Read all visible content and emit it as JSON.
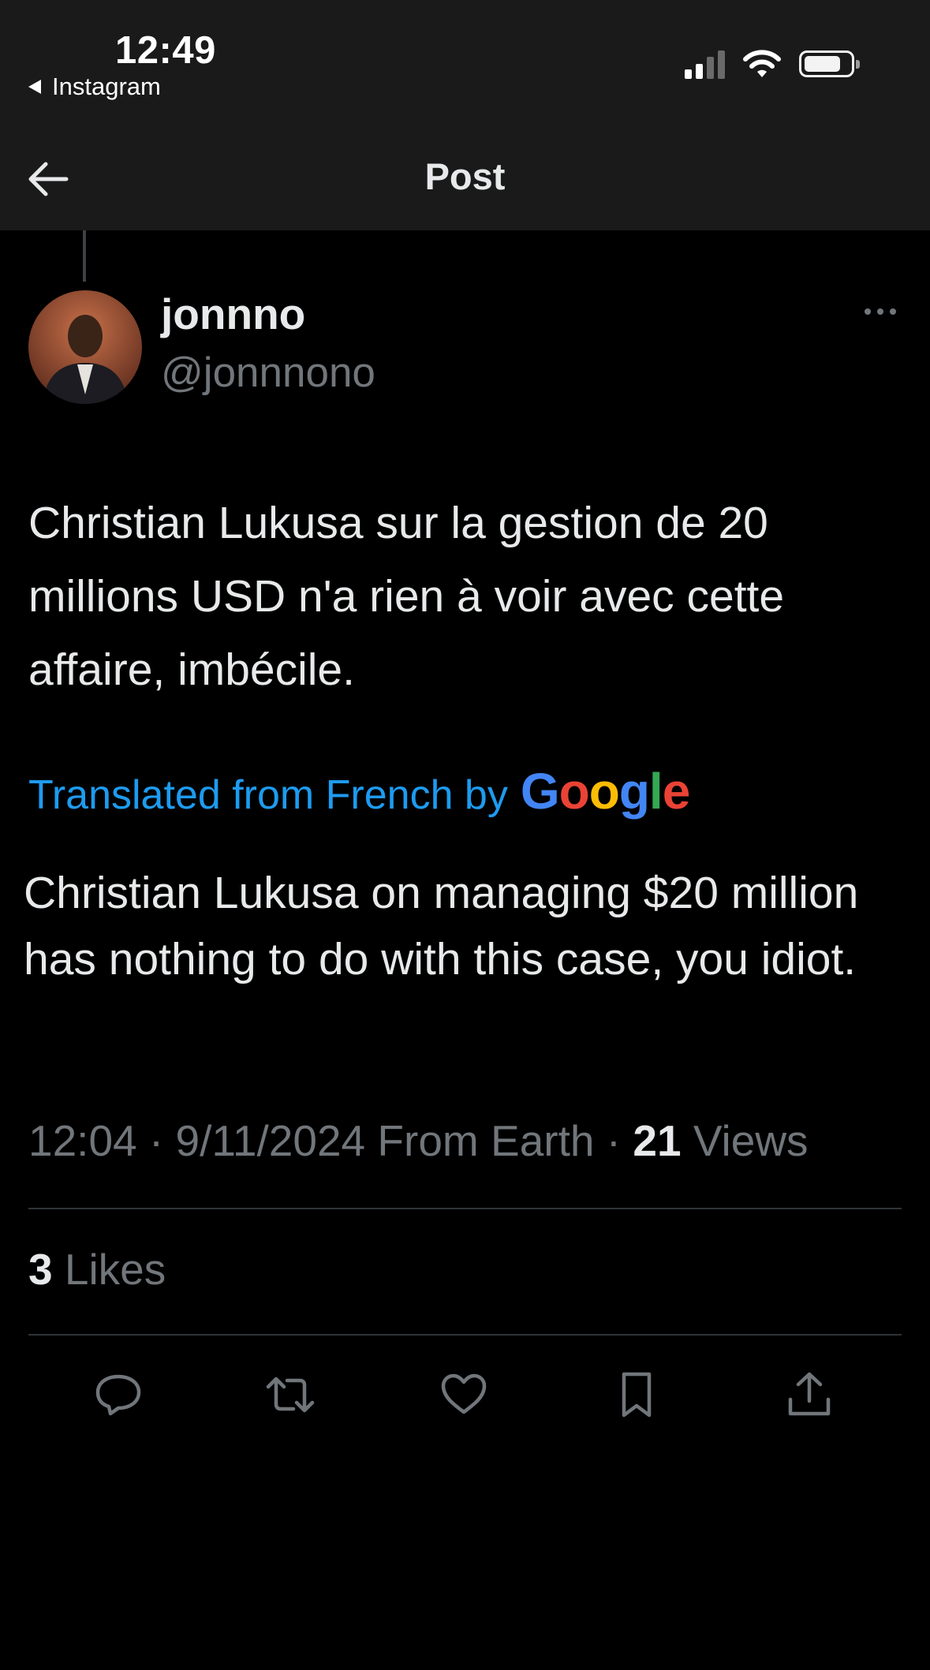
{
  "status_bar": {
    "time": "12:49",
    "back_app": "Instagram"
  },
  "header": {
    "title": "Post"
  },
  "author": {
    "name": "jonnno",
    "handle": "@jonnnono"
  },
  "post": {
    "text": "Christian Lukusa sur la gestion de 20 millions USD n'a rien à voir avec cette affaire, imbécile.",
    "translated_label": "Translated from French by",
    "translation_provider": "Google",
    "translation": "Christian Lukusa on managing $20 million has nothing to do with this case, you idiot."
  },
  "meta": {
    "time": "12:04",
    "date": "9/11/2024",
    "source": "From Earth",
    "views_count": "21",
    "views_label": "Views"
  },
  "stats": {
    "likes_count": "3",
    "likes_label": "Likes"
  },
  "actions": [
    {
      "name": "reply-icon"
    },
    {
      "name": "repost-icon"
    },
    {
      "name": "like-icon"
    },
    {
      "name": "bookmark-icon"
    },
    {
      "name": "share-icon"
    }
  ],
  "colors": {
    "background": "#000000",
    "text": "#e7e9ea",
    "secondary_text": "#71767b",
    "link_blue": "#1d9bf0",
    "divider": "#2f3336"
  }
}
